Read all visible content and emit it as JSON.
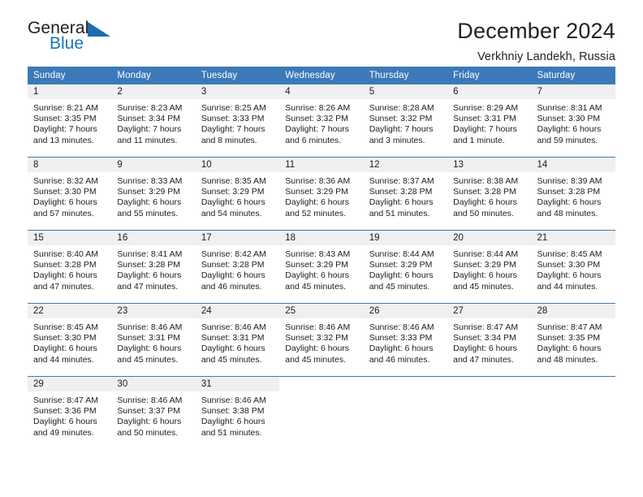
{
  "brand": {
    "name_part1": "General",
    "name_part2": "Blue",
    "logo_icon": "triangle-flag-icon",
    "accent_color": "#1b75bb"
  },
  "header": {
    "month_title": "December 2024",
    "location": "Verkhniy Landekh, Russia"
  },
  "theme": {
    "header_blue": "#3c79b8",
    "daynum_band": "#f0f0f0",
    "text": "#1c1c1c"
  },
  "calendar": {
    "weekday_headers": [
      "Sunday",
      "Monday",
      "Tuesday",
      "Wednesday",
      "Thursday",
      "Friday",
      "Saturday"
    ],
    "weeks": [
      [
        {
          "day": "1",
          "sunrise": "Sunrise: 8:21 AM",
          "sunset": "Sunset: 3:35 PM",
          "daylight_line1": "Daylight: 7 hours",
          "daylight_line2": "and 13 minutes."
        },
        {
          "day": "2",
          "sunrise": "Sunrise: 8:23 AM",
          "sunset": "Sunset: 3:34 PM",
          "daylight_line1": "Daylight: 7 hours",
          "daylight_line2": "and 11 minutes."
        },
        {
          "day": "3",
          "sunrise": "Sunrise: 8:25 AM",
          "sunset": "Sunset: 3:33 PM",
          "daylight_line1": "Daylight: 7 hours",
          "daylight_line2": "and 8 minutes."
        },
        {
          "day": "4",
          "sunrise": "Sunrise: 8:26 AM",
          "sunset": "Sunset: 3:32 PM",
          "daylight_line1": "Daylight: 7 hours",
          "daylight_line2": "and 6 minutes."
        },
        {
          "day": "5",
          "sunrise": "Sunrise: 8:28 AM",
          "sunset": "Sunset: 3:32 PM",
          "daylight_line1": "Daylight: 7 hours",
          "daylight_line2": "and 3 minutes."
        },
        {
          "day": "6",
          "sunrise": "Sunrise: 8:29 AM",
          "sunset": "Sunset: 3:31 PM",
          "daylight_line1": "Daylight: 7 hours",
          "daylight_line2": "and 1 minute."
        },
        {
          "day": "7",
          "sunrise": "Sunrise: 8:31 AM",
          "sunset": "Sunset: 3:30 PM",
          "daylight_line1": "Daylight: 6 hours",
          "daylight_line2": "and 59 minutes."
        }
      ],
      [
        {
          "day": "8",
          "sunrise": "Sunrise: 8:32 AM",
          "sunset": "Sunset: 3:30 PM",
          "daylight_line1": "Daylight: 6 hours",
          "daylight_line2": "and 57 minutes."
        },
        {
          "day": "9",
          "sunrise": "Sunrise: 8:33 AM",
          "sunset": "Sunset: 3:29 PM",
          "daylight_line1": "Daylight: 6 hours",
          "daylight_line2": "and 55 minutes."
        },
        {
          "day": "10",
          "sunrise": "Sunrise: 8:35 AM",
          "sunset": "Sunset: 3:29 PM",
          "daylight_line1": "Daylight: 6 hours",
          "daylight_line2": "and 54 minutes."
        },
        {
          "day": "11",
          "sunrise": "Sunrise: 8:36 AM",
          "sunset": "Sunset: 3:29 PM",
          "daylight_line1": "Daylight: 6 hours",
          "daylight_line2": "and 52 minutes."
        },
        {
          "day": "12",
          "sunrise": "Sunrise: 8:37 AM",
          "sunset": "Sunset: 3:28 PM",
          "daylight_line1": "Daylight: 6 hours",
          "daylight_line2": "and 51 minutes."
        },
        {
          "day": "13",
          "sunrise": "Sunrise: 8:38 AM",
          "sunset": "Sunset: 3:28 PM",
          "daylight_line1": "Daylight: 6 hours",
          "daylight_line2": "and 50 minutes."
        },
        {
          "day": "14",
          "sunrise": "Sunrise: 8:39 AM",
          "sunset": "Sunset: 3:28 PM",
          "daylight_line1": "Daylight: 6 hours",
          "daylight_line2": "and 48 minutes."
        }
      ],
      [
        {
          "day": "15",
          "sunrise": "Sunrise: 8:40 AM",
          "sunset": "Sunset: 3:28 PM",
          "daylight_line1": "Daylight: 6 hours",
          "daylight_line2": "and 47 minutes."
        },
        {
          "day": "16",
          "sunrise": "Sunrise: 8:41 AM",
          "sunset": "Sunset: 3:28 PM",
          "daylight_line1": "Daylight: 6 hours",
          "daylight_line2": "and 47 minutes."
        },
        {
          "day": "17",
          "sunrise": "Sunrise: 8:42 AM",
          "sunset": "Sunset: 3:28 PM",
          "daylight_line1": "Daylight: 6 hours",
          "daylight_line2": "and 46 minutes."
        },
        {
          "day": "18",
          "sunrise": "Sunrise: 8:43 AM",
          "sunset": "Sunset: 3:29 PM",
          "daylight_line1": "Daylight: 6 hours",
          "daylight_line2": "and 45 minutes."
        },
        {
          "day": "19",
          "sunrise": "Sunrise: 8:44 AM",
          "sunset": "Sunset: 3:29 PM",
          "daylight_line1": "Daylight: 6 hours",
          "daylight_line2": "and 45 minutes."
        },
        {
          "day": "20",
          "sunrise": "Sunrise: 8:44 AM",
          "sunset": "Sunset: 3:29 PM",
          "daylight_line1": "Daylight: 6 hours",
          "daylight_line2": "and 45 minutes."
        },
        {
          "day": "21",
          "sunrise": "Sunrise: 8:45 AM",
          "sunset": "Sunset: 3:30 PM",
          "daylight_line1": "Daylight: 6 hours",
          "daylight_line2": "and 44 minutes."
        }
      ],
      [
        {
          "day": "22",
          "sunrise": "Sunrise: 8:45 AM",
          "sunset": "Sunset: 3:30 PM",
          "daylight_line1": "Daylight: 6 hours",
          "daylight_line2": "and 44 minutes."
        },
        {
          "day": "23",
          "sunrise": "Sunrise: 8:46 AM",
          "sunset": "Sunset: 3:31 PM",
          "daylight_line1": "Daylight: 6 hours",
          "daylight_line2": "and 45 minutes."
        },
        {
          "day": "24",
          "sunrise": "Sunrise: 8:46 AM",
          "sunset": "Sunset: 3:31 PM",
          "daylight_line1": "Daylight: 6 hours",
          "daylight_line2": "and 45 minutes."
        },
        {
          "day": "25",
          "sunrise": "Sunrise: 8:46 AM",
          "sunset": "Sunset: 3:32 PM",
          "daylight_line1": "Daylight: 6 hours",
          "daylight_line2": "and 45 minutes."
        },
        {
          "day": "26",
          "sunrise": "Sunrise: 8:46 AM",
          "sunset": "Sunset: 3:33 PM",
          "daylight_line1": "Daylight: 6 hours",
          "daylight_line2": "and 46 minutes."
        },
        {
          "day": "27",
          "sunrise": "Sunrise: 8:47 AM",
          "sunset": "Sunset: 3:34 PM",
          "daylight_line1": "Daylight: 6 hours",
          "daylight_line2": "and 47 minutes."
        },
        {
          "day": "28",
          "sunrise": "Sunrise: 8:47 AM",
          "sunset": "Sunset: 3:35 PM",
          "daylight_line1": "Daylight: 6 hours",
          "daylight_line2": "and 48 minutes."
        }
      ],
      [
        {
          "day": "29",
          "sunrise": "Sunrise: 8:47 AM",
          "sunset": "Sunset: 3:36 PM",
          "daylight_line1": "Daylight: 6 hours",
          "daylight_line2": "and 49 minutes."
        },
        {
          "day": "30",
          "sunrise": "Sunrise: 8:46 AM",
          "sunset": "Sunset: 3:37 PM",
          "daylight_line1": "Daylight: 6 hours",
          "daylight_line2": "and 50 minutes."
        },
        {
          "day": "31",
          "sunrise": "Sunrise: 8:46 AM",
          "sunset": "Sunset: 3:38 PM",
          "daylight_line1": "Daylight: 6 hours",
          "daylight_line2": "and 51 minutes."
        },
        {
          "day": "",
          "sunrise": "",
          "sunset": "",
          "daylight_line1": "",
          "daylight_line2": ""
        },
        {
          "day": "",
          "sunrise": "",
          "sunset": "",
          "daylight_line1": "",
          "daylight_line2": ""
        },
        {
          "day": "",
          "sunrise": "",
          "sunset": "",
          "daylight_line1": "",
          "daylight_line2": ""
        },
        {
          "day": "",
          "sunrise": "",
          "sunset": "",
          "daylight_line1": "",
          "daylight_line2": ""
        }
      ]
    ]
  }
}
